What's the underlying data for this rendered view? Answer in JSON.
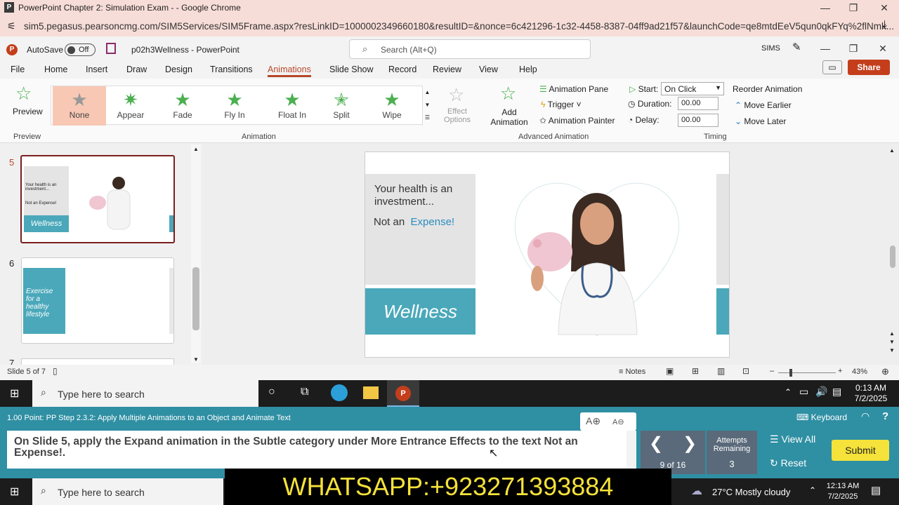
{
  "browser": {
    "title": "PowerPoint Chapter 2: Simulation Exam - - Google Chrome",
    "url": "sim5.pegasus.pearsoncmg.com/SIM5Services/SIM5Frame.aspx?resLinkID=1000002349660180&resultID=&nonce=6c421296-1c32-4458-8387-04ff9ad21f57&launchCode=qe8mtdEeV5qun0qkFYq%2flNmk..."
  },
  "ppt": {
    "autosave": "AutoSave",
    "toggle": "Off",
    "filename": "p02h3Wellness - PowerPoint",
    "search_placeholder": "Search (Alt+Q)",
    "user": "SIMS",
    "share": "Share"
  },
  "tabs": [
    "File",
    "Home",
    "Insert",
    "Draw",
    "Design",
    "Transitions",
    "Animations",
    "Slide Show",
    "Record",
    "Review",
    "View",
    "Help"
  ],
  "ribbon": {
    "preview": "Preview",
    "preview_group": "Preview",
    "gallery": [
      "None",
      "Appear",
      "Fade",
      "Fly In",
      "Float In",
      "Split",
      "Wipe"
    ],
    "effect_options": "Effect Options",
    "animation_group": "Animation",
    "add_animation": "Add Animation",
    "animation_pane": "Animation Pane",
    "trigger": "Trigger",
    "animation_painter": "Animation Painter",
    "advanced_group": "Advanced Animation",
    "start_label": "Start:",
    "start_value": "On Click",
    "duration_label": "Duration:",
    "duration_value": "00.00",
    "delay_label": "Delay:",
    "delay_value": "00.00",
    "timing_group": "Timing",
    "reorder": "Reorder Animation",
    "move_earlier": "Move Earlier",
    "move_later": "Move Later"
  },
  "thumbs": [
    {
      "num": "5",
      "t1": "Your health is an investment...",
      "t2": "Not an Expense!",
      "band": "Wellness"
    },
    {
      "num": "6",
      "band": "Exercise for a healthy lifestyle"
    },
    {
      "num": "7"
    }
  ],
  "slide": {
    "line1": "Your health is an investment...",
    "not_an": "Not an",
    "expense": "Expense!",
    "wellness": "Wellness"
  },
  "status": {
    "slide": "Slide 5 of 7",
    "notes": "Notes",
    "zoom": "43%"
  },
  "taskbar": {
    "search": "Type here to search",
    "time": "0:13 AM",
    "date": "7/2/2025",
    "time2": "12:13 AM",
    "date2": "7/2/2025",
    "weather": "27°C  Mostly cloudy"
  },
  "sim": {
    "step": "1.00 Point: PP Step 2.3.2: Apply Multiple Animations to an Object and Animate Text",
    "instruction": "On Slide 5, apply the Expand animation in the Subtle category under More Entrance Effects to the text Not an Expense!.",
    "nav": "9 of 16",
    "attempts_label": "Attempts Remaining",
    "attempts": "3",
    "view_all": "View All",
    "reset": "Reset",
    "submit": "Submit",
    "keyboard": "Keyboard"
  },
  "overlay": "WHATSAPP:+923271393884",
  "colors": {
    "teal": "#4aa8ba",
    "accent": "#b7472a",
    "submit": "#f5e23a"
  }
}
